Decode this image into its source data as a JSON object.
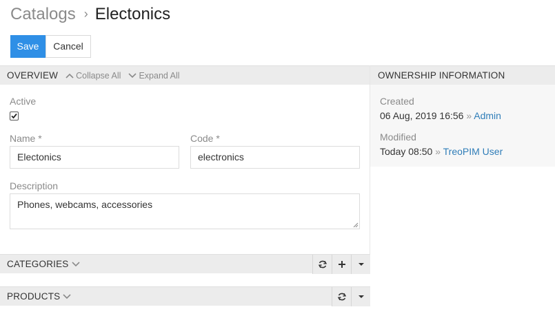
{
  "breadcrumb": {
    "parent": "Catalogs",
    "separator": "›",
    "current": "Electonics"
  },
  "buttons": {
    "save": "Save",
    "cancel": "Cancel"
  },
  "overview": {
    "title": "OVERVIEW",
    "collapse_all": "Collapse All",
    "expand_all": "Expand All",
    "active_label": "Active",
    "active_checked": true,
    "name_label": "Name *",
    "name_value": "Electonics",
    "code_label": "Code *",
    "code_value": "electronics",
    "description_label": "Description",
    "description_value": "Phones, webcams, accessories"
  },
  "ownership": {
    "title": "OWNERSHIP INFORMATION",
    "created_label": "Created",
    "created_date": "06 Aug, 2019 16:56",
    "created_sep": "»",
    "created_by": "Admin",
    "modified_label": "Modified",
    "modified_date": "Today 08:50",
    "modified_sep": "»",
    "modified_by": "TreoPIM User"
  },
  "categories": {
    "title": "CATEGORIES",
    "actions": [
      "refresh-icon",
      "plus-icon",
      "caret-down-icon"
    ]
  },
  "products": {
    "title": "PRODUCTS",
    "actions": [
      "refresh-icon",
      "caret-down-icon"
    ]
  },
  "colors": {
    "primary": "#2f8fe6",
    "link": "#2f7db8",
    "header_bg": "#ececec",
    "muted": "#8a8a8a"
  }
}
